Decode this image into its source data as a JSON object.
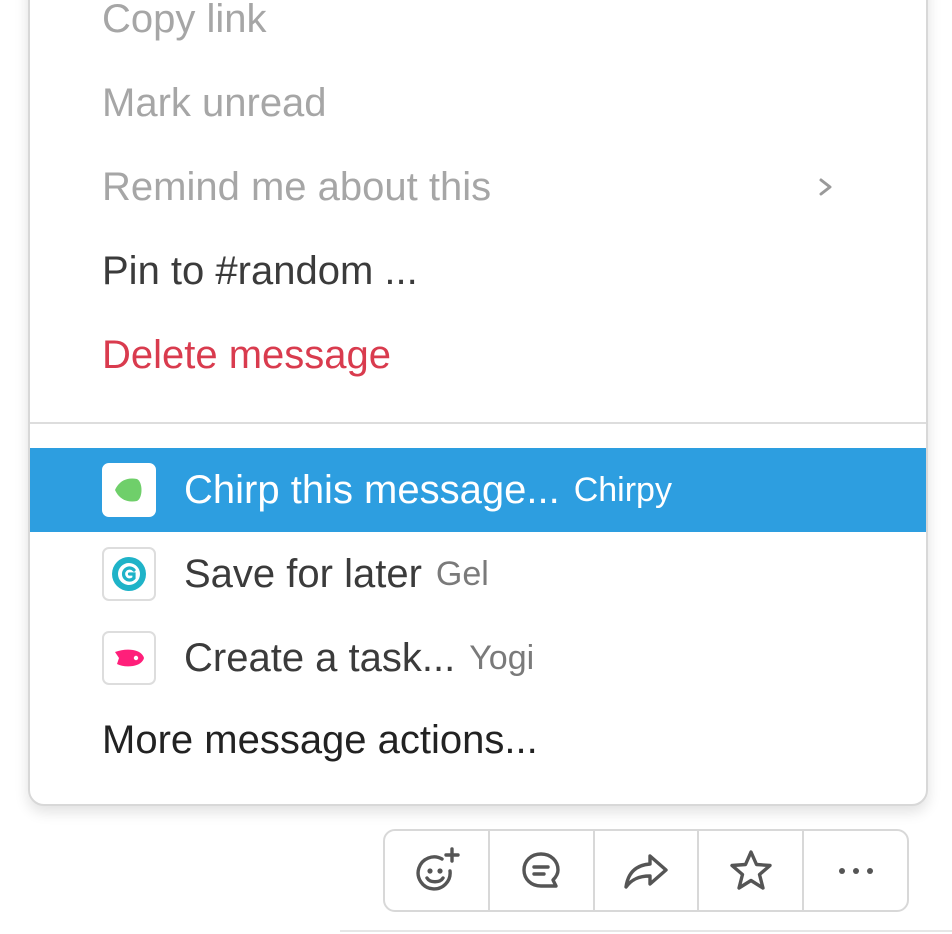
{
  "menu": {
    "items": [
      {
        "label": "Copy link",
        "state": "disabled"
      },
      {
        "label": "Mark unread",
        "state": "disabled"
      },
      {
        "label": "Remind me about this",
        "state": "disabled",
        "submenu": true
      },
      {
        "label": "Pin to #random ...",
        "state": "normal"
      },
      {
        "label": "Delete message",
        "state": "danger"
      }
    ],
    "app_actions": [
      {
        "label": "Chirp this message...",
        "app": "Chirpy",
        "icon": "chirpy-logo-icon",
        "selected": true
      },
      {
        "label": "Save for later",
        "app": "Gel",
        "icon": "gel-logo-icon",
        "selected": false
      },
      {
        "label": "Create a task...",
        "app": "Yogi",
        "icon": "yogi-logo-icon",
        "selected": false
      }
    ],
    "more_label": "More message actions..."
  },
  "toolbar": {
    "buttons": [
      {
        "name": "add-reaction",
        "icon": "add-reaction-icon"
      },
      {
        "name": "start-thread",
        "icon": "thread-icon"
      },
      {
        "name": "share-message",
        "icon": "share-icon"
      },
      {
        "name": "save-message",
        "icon": "star-icon"
      },
      {
        "name": "more-actions",
        "icon": "ellipsis-icon"
      }
    ]
  },
  "colors": {
    "selected_bg": "#2d9ee0",
    "danger": "#d93b4e",
    "disabled": "#a6a6a6",
    "chirpy": "#6fcf6a",
    "gel": "#1fb3c8",
    "yogi": "#ff1f7a"
  }
}
